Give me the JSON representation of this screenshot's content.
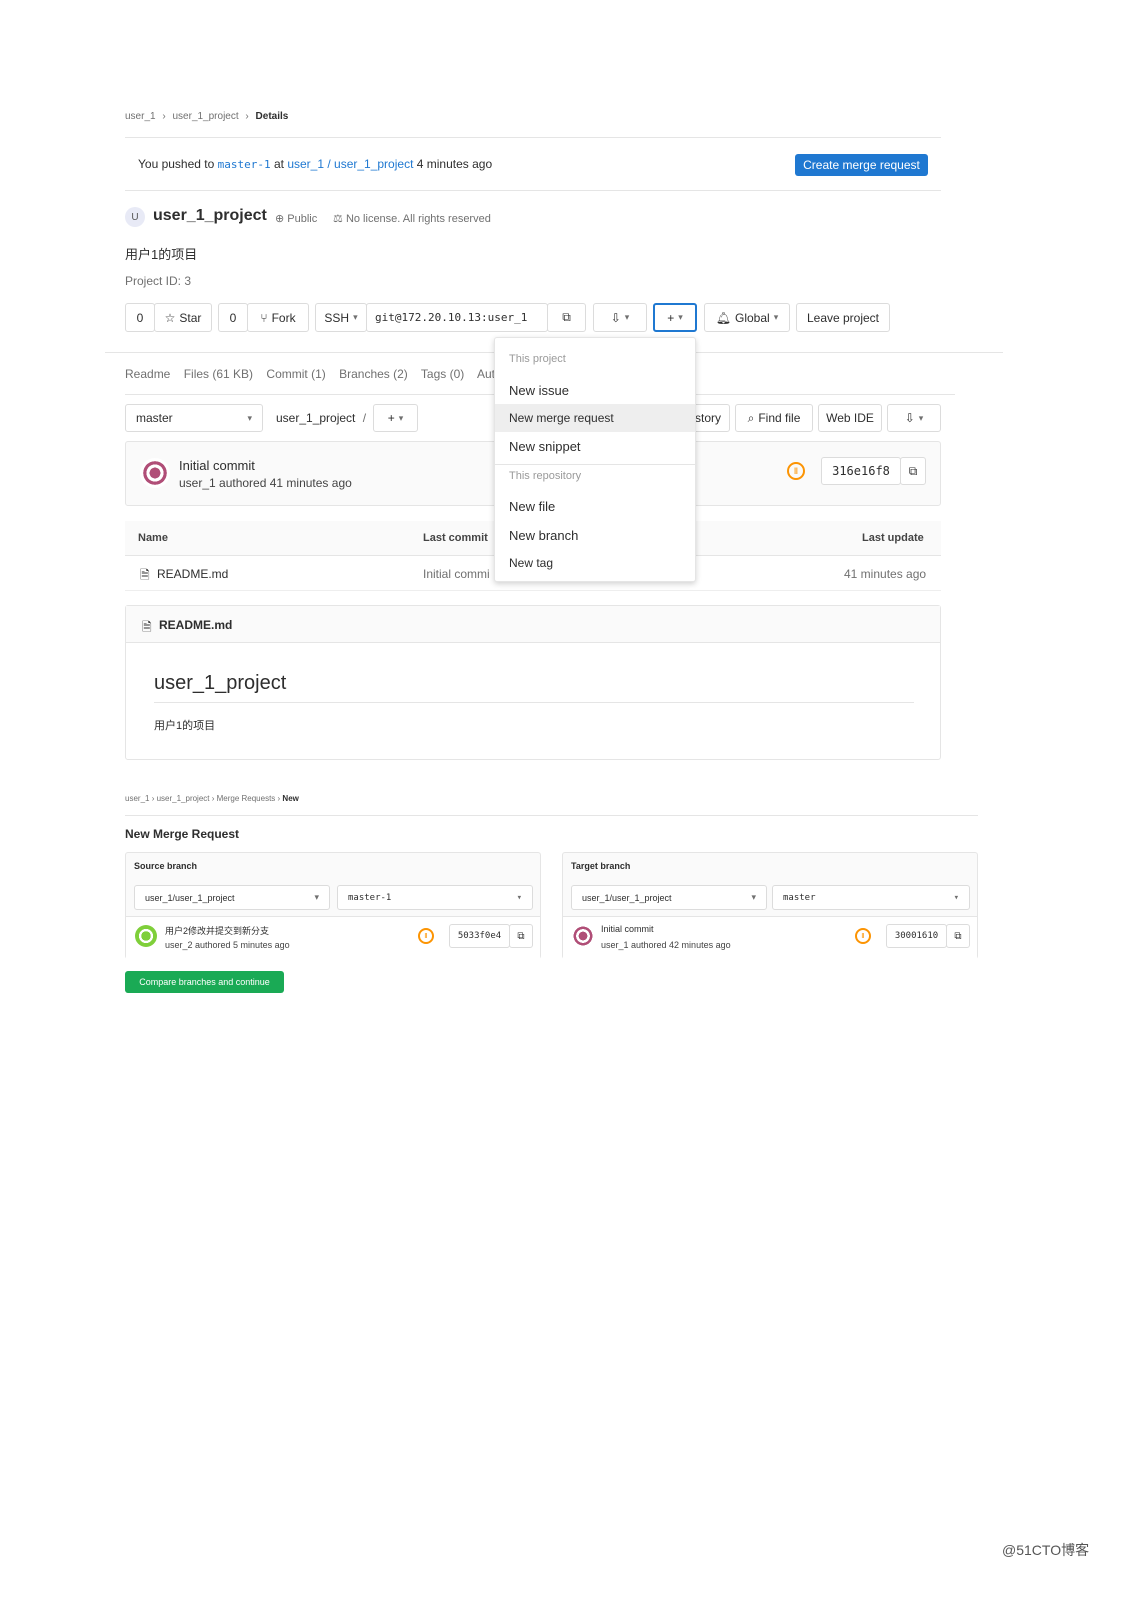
{
  "breadcrumb": {
    "items": [
      "user_1",
      "user_1_project",
      "Details"
    ]
  },
  "push_banner": {
    "prefix": "You pushed to",
    "branch": "master-1",
    "at": "at",
    "namespace": "user_1 / user_1_project",
    "suffix": "4 minutes ago",
    "button": "Create merge request"
  },
  "project": {
    "avatar_letter": "U",
    "name": "user_1_project",
    "visibility": "Public",
    "license": "No license. All rights reserved",
    "description": "用户1的项目",
    "project_id": "Project ID: 3"
  },
  "actions": {
    "star_count": "0",
    "star_label": "Star",
    "fork_count": "0",
    "fork_label": "Fork",
    "clone_protocol": "SSH",
    "clone_url": "git@172.20.10.13:user_1",
    "notification": "Global",
    "leave": "Leave project"
  },
  "add_dropdown": {
    "header_project": "This project",
    "new_issue": "New issue",
    "new_merge_request": "New merge request",
    "new_snippet": "New snippet",
    "header_repo": "This repository",
    "new_file": "New file",
    "new_branch": "New branch",
    "new_tag": "New tag"
  },
  "stats_tabs": [
    "Readme",
    "Files (61 KB)",
    "Commit (1)",
    "Branches (2)",
    "Tags (0)",
    "Aut"
  ],
  "repo_toolbar": {
    "branch": "master",
    "path": "user_1_project",
    "separator": "/",
    "history": "story",
    "find_file": "Find file",
    "web_ide": "Web IDE"
  },
  "last_commit": {
    "title": "Initial commit",
    "meta": "user_1 authored 41 minutes ago",
    "sha": "316e16f8"
  },
  "file_table": {
    "headers": {
      "name": "Name",
      "last_commit": "Last commit",
      "last_update": "Last update"
    },
    "rows": [
      {
        "name": "README.md",
        "commit": "Initial commi",
        "updated": "41 minutes ago"
      }
    ]
  },
  "readme": {
    "filename": "README.md",
    "heading": "user_1_project",
    "body": "用户1的项目"
  },
  "mr": {
    "breadcrumb": [
      "user_1",
      "user_1_project",
      "Merge Requests",
      "New"
    ],
    "title": "New Merge Request",
    "source": {
      "label": "Source branch",
      "project": "user_1/user_1_project",
      "branch": "master-1",
      "commit_title": "用户2修改并提交到新分支",
      "commit_meta": "user_2 authored 5 minutes ago",
      "sha": "5033f0e4"
    },
    "target": {
      "label": "Target branch",
      "project": "user_1/user_1_project",
      "branch": "master",
      "commit_title": "Initial commit",
      "commit_meta": "user_1 authored 42 minutes ago",
      "sha": "30001610"
    },
    "button": "Compare branches and continue"
  },
  "watermark": "@51CTO博客",
  "colors": {
    "primary": "#1f78d1",
    "success": "#1aaa55",
    "pending": "#fc9403",
    "border": "#e5e5e5"
  }
}
